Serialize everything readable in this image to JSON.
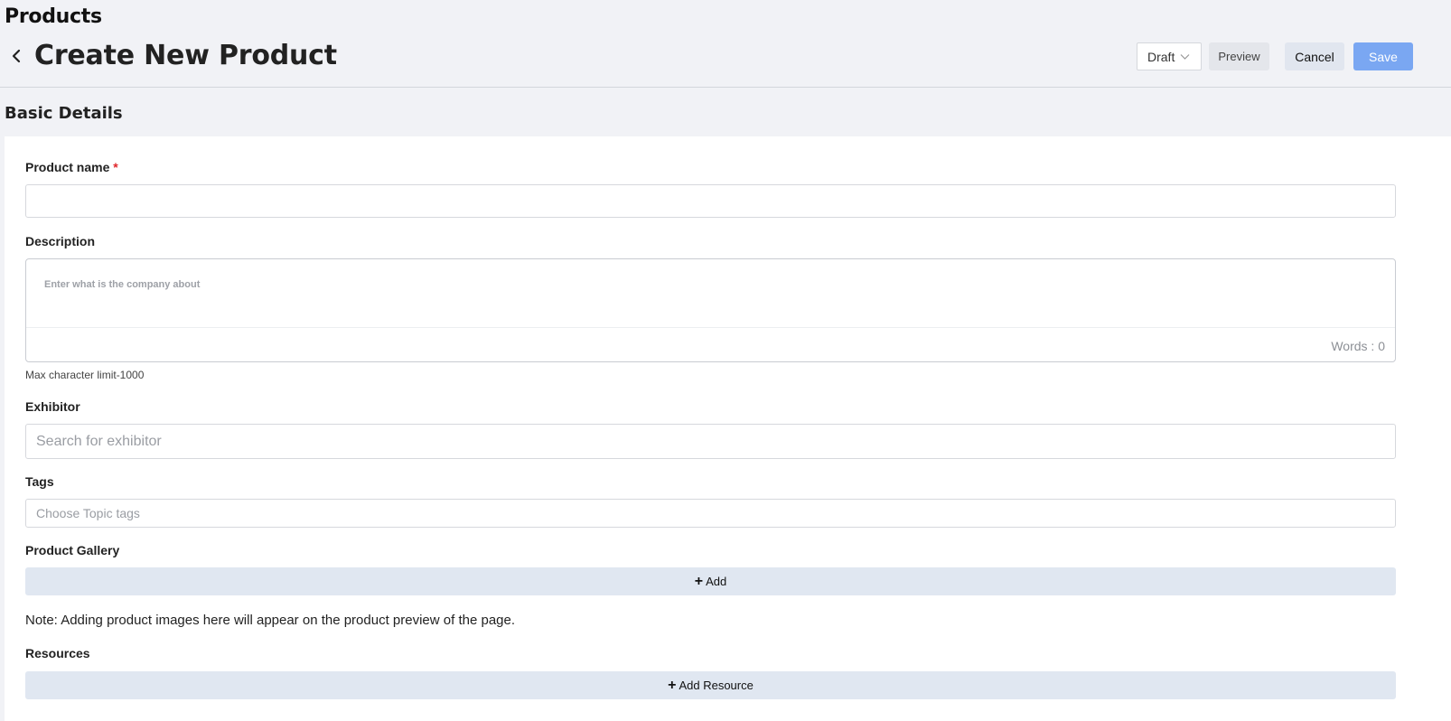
{
  "app": {
    "title": "Products"
  },
  "header": {
    "title": "Create New Product",
    "status_value": "Draft",
    "preview_label": "Preview",
    "cancel_label": "Cancel",
    "save_label": "Save"
  },
  "section": {
    "title": "Basic Details"
  },
  "form": {
    "product_name": {
      "label": "Product name",
      "required_mark": "*",
      "value": ""
    },
    "description": {
      "label": "Description",
      "placeholder": "Enter what is the company about",
      "word_count": "Words : 0",
      "helper": "Max character limit-1000"
    },
    "exhibitor": {
      "label": "Exhibitor",
      "placeholder": "Search for exhibitor"
    },
    "tags": {
      "label": "Tags",
      "placeholder": "Choose Topic tags"
    },
    "gallery": {
      "label": "Product Gallery",
      "add_label": "Add",
      "note": "Note: Adding product images here will appear on the product preview of the page."
    },
    "resources": {
      "label": "Resources",
      "add_label": "Add Resource"
    }
  },
  "colors": {
    "page_bg": "#f1f2f6",
    "save_button": "#7aa7f2",
    "add_bar": "#e0e7f1",
    "required": "#e0272b"
  },
  "icons": {
    "back": "chevron-left-icon",
    "status_dropdown": "chevron-down-icon",
    "add": "plus-icon"
  }
}
